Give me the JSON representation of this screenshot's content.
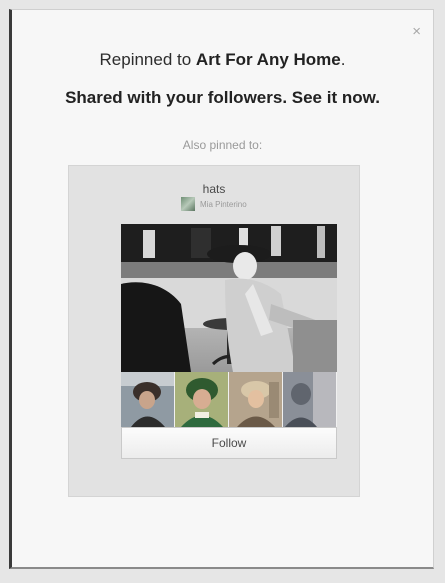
{
  "dialog": {
    "close_glyph": "×",
    "line1_prefix": "Repinned to ",
    "line1_board": "Art For Any Home",
    "line1_suffix": ".",
    "line2": "Shared with your followers. See it now.",
    "also_pinned": "Also pinned to:"
  },
  "board": {
    "name": "hats",
    "owner": "Mia Pinterino",
    "follow_label": "Follow",
    "thumbnails": [
      "thumbnail-1",
      "thumbnail-2",
      "thumbnail-3",
      "thumbnail-4"
    ]
  },
  "colors": {
    "card_bg": "#e2e2e2",
    "dialog_bg": "#f7f7f7",
    "text_dark": "#222222",
    "text_muted": "#9a9a9a"
  }
}
